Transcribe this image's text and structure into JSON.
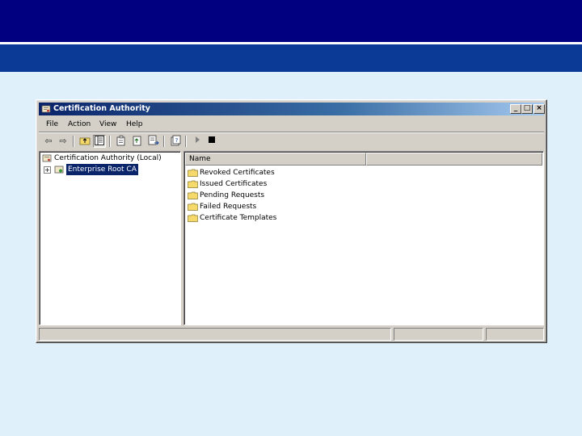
{
  "window": {
    "title": "Certification Authority",
    "controls": {
      "minimize": "_",
      "maximize": "□",
      "close": "×"
    }
  },
  "menu": [
    "File",
    "Action",
    "View",
    "Help"
  ],
  "toolbar": [
    "back-icon",
    "forward-icon",
    "up-folder-icon",
    "show-tree-icon",
    "properties-icon",
    "export-icon",
    "export-list-icon",
    "help-icon",
    "start-service-icon",
    "stop-service-icon"
  ],
  "tree": {
    "root": "Certification Authority (Local)",
    "child": "Enterprise Root CA",
    "child_expander": "+"
  },
  "list": {
    "columns": [
      "Name",
      ""
    ],
    "items": [
      "Revoked Certificates",
      "Issued Certificates",
      "Pending Requests",
      "Failed Requests",
      "Certificate Templates"
    ]
  },
  "colors": {
    "band_top": "#000080",
    "band_bottom": "#0a3a96",
    "page_background": "#dff0fb",
    "titlebar_start": "#0a246a",
    "selection": "#0a246a"
  }
}
